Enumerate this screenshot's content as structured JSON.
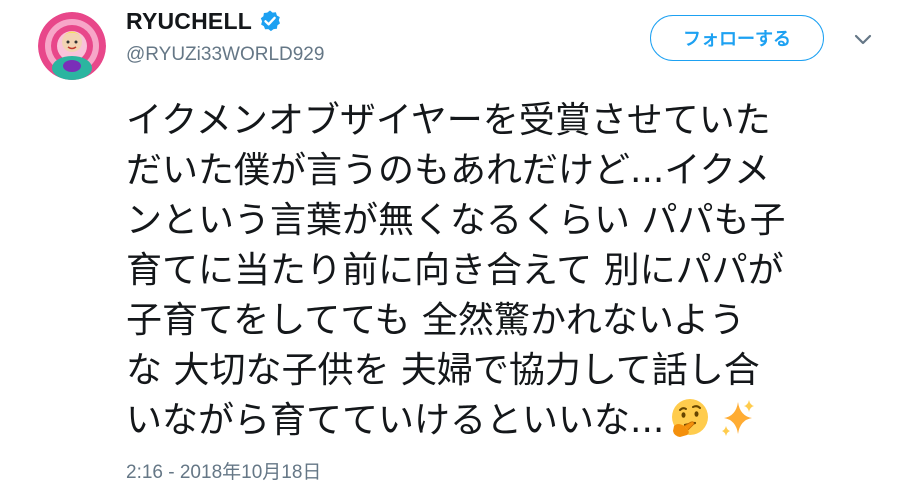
{
  "user": {
    "display_name": "RYUCHELL",
    "handle": "@RYUZi33WORLD929",
    "verified": true
  },
  "follow_button": {
    "label": "フォローする"
  },
  "tweet": {
    "lines": [
      "イクメンオブザイヤーを受賞させていた",
      "だいた僕が言うのもあれだけど...イクメ",
      "ンという言葉が無くなるくらい パパも子",
      "育てに当たり前に向き合えて 別にパパが",
      "子育てをしてても 全然驚かれないよう",
      "な 大切な子供を 夫婦で協力して話し合",
      "いながら育てていけるといいな..."
    ],
    "emojis": [
      "thinking-face-emoji",
      "sparkles-emoji"
    ]
  },
  "timestamp": "2:16 - 2018年10月18日",
  "colors": {
    "accent": "#1da1f2",
    "text": "#14171a",
    "secondary": "#657786"
  }
}
